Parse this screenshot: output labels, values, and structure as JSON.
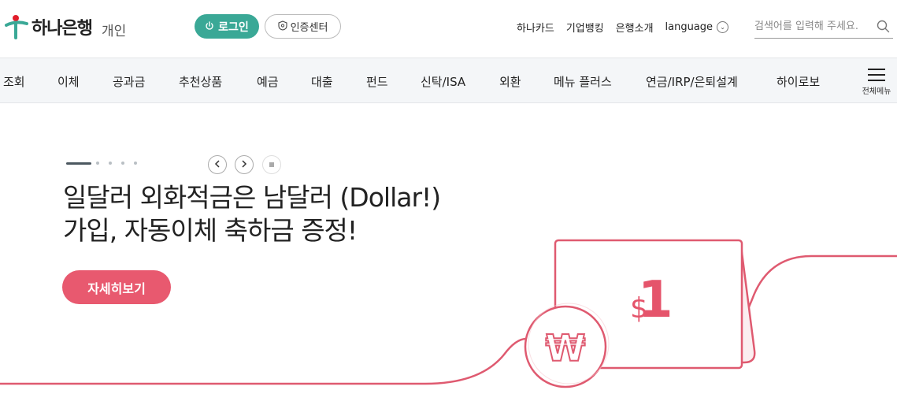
{
  "header": {
    "logo_text": "하나은행",
    "logo_sub": "개인",
    "login_label": "로그인",
    "cert_label": "인증센터",
    "util_links": [
      "하나카드",
      "기업뱅킹",
      "은행소개"
    ],
    "language_label": "language",
    "search_placeholder": "검색어를 입력해 주세요."
  },
  "nav": {
    "items": [
      "조회",
      "이체",
      "공과금",
      "추천상품",
      "예금",
      "대출",
      "펀드",
      "신탁/ISA",
      "외환",
      "메뉴 플러스",
      "연금/IRP/은퇴설계",
      "하이로보"
    ],
    "all_menu_label": "전체메뉴"
  },
  "hero": {
    "headline_line1": "일달러 외화적금은 남달러 (Dollar!)",
    "headline_line2": "가입, 자동이체 축하금 증정!",
    "detail_button": "자세히보기",
    "bill_value": "1",
    "bill_currency": "$",
    "coin_symbol": "₩"
  },
  "colors": {
    "brand_green": "#3aa896",
    "brand_red": "#e11d2b",
    "accent_pink": "#e8596f",
    "line_pink": "#df5a70",
    "nav_bg": "#f4f6f8"
  }
}
